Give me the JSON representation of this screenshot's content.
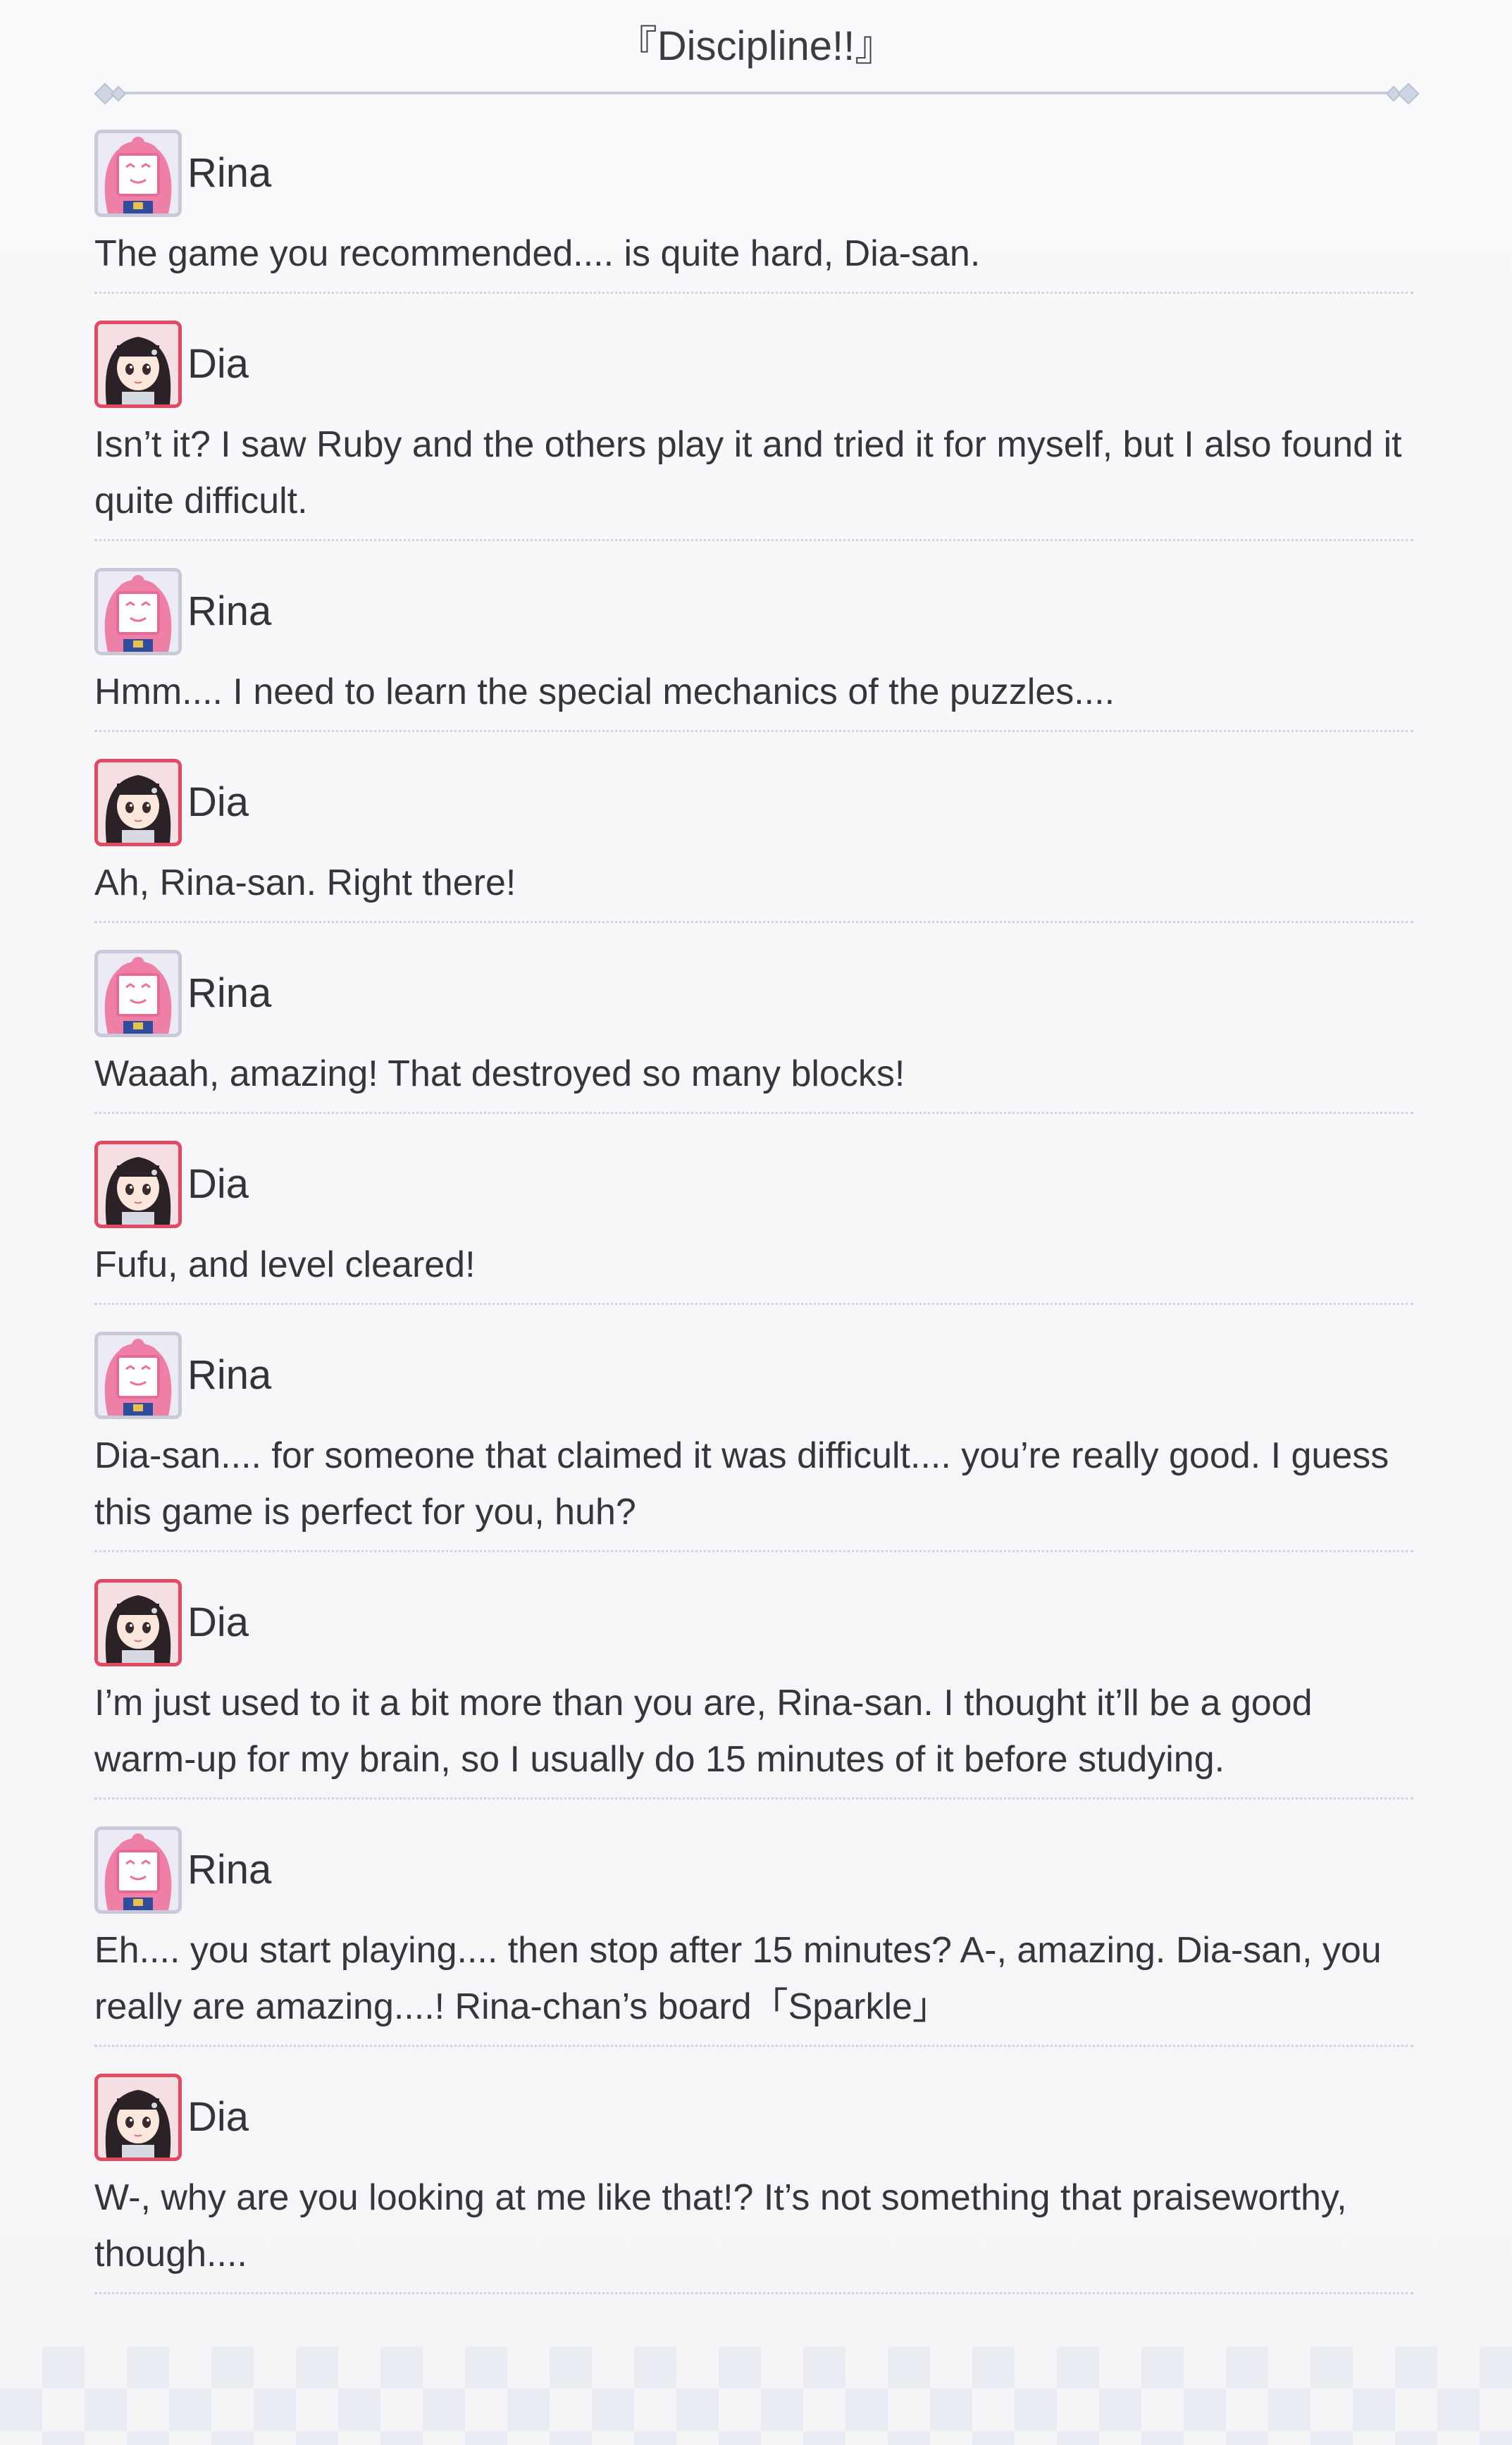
{
  "header": {
    "title": "『Discipline!!』"
  },
  "dialogue": [
    {
      "speaker": "Rina",
      "avatar": "rina",
      "text": "The game you recommended.... is quite hard, Dia-san."
    },
    {
      "speaker": "Dia",
      "avatar": "dia",
      "text": "Isn’t it? I saw Ruby and the others play it and tried it for myself, but I also found it quite difficult."
    },
    {
      "speaker": "Rina",
      "avatar": "rina",
      "text": "Hmm.... I need to learn the special mechanics of the puzzles...."
    },
    {
      "speaker": "Dia",
      "avatar": "dia",
      "text": "Ah, Rina-san. Right there!"
    },
    {
      "speaker": "Rina",
      "avatar": "rina",
      "text": "Waaah, amazing! That destroyed so many blocks!"
    },
    {
      "speaker": "Dia",
      "avatar": "dia",
      "text": "Fufu, and level cleared!"
    },
    {
      "speaker": "Rina",
      "avatar": "rina",
      "text": "Dia-san.... for someone that claimed it was difficult.... you’re really good. I guess this game is perfect for you, huh?"
    },
    {
      "speaker": "Dia",
      "avatar": "dia",
      "text": "I’m just used to it a bit more than you are, Rina-san. I thought it’ll be a good warm-up for my brain, so I usually do 15 minutes of it before studying."
    },
    {
      "speaker": "Rina",
      "avatar": "rina",
      "text": "Eh.... you start playing.... then stop after 15 minutes? A-, amazing. Dia-san, you really are amazing....! Rina-chan’s board「Sparkle」"
    },
    {
      "speaker": "Dia",
      "avatar": "dia",
      "text": "W-, why are you looking at me like that!? It’s not something that praiseworthy, though...."
    }
  ],
  "colors": {
    "dia_frame": "#e24a63",
    "rina_frame": "#c9cad9",
    "rina_hair": "#ee7fa6",
    "dia_hair": "#2a2226"
  }
}
